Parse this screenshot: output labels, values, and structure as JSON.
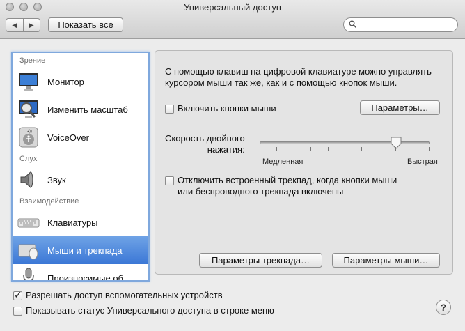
{
  "window": {
    "title": "Универсальный доступ"
  },
  "toolbar": {
    "show_all_label": "Показать все"
  },
  "sidebar": {
    "groups": [
      {
        "label": "Зрение"
      },
      {
        "label": "Слух"
      },
      {
        "label": "Взаимодействие"
      }
    ],
    "items": [
      {
        "label": "Монитор",
        "icon": "monitor-icon"
      },
      {
        "label": "Изменить масштаб",
        "icon": "zoom-icon"
      },
      {
        "label": "VoiceOver",
        "icon": "voiceover-icon"
      },
      {
        "label": "Звук",
        "icon": "speaker-icon"
      },
      {
        "label": "Клавиатуры",
        "icon": "keyboard-icon"
      },
      {
        "label": "Мыши и трекпада",
        "icon": "mouse-icon",
        "selected": true
      },
      {
        "label": "Произносимые об",
        "icon": "microphone-icon"
      }
    ]
  },
  "panel": {
    "description": "С помощью клавиш на цифровой клавиатуре можно управлять курсором мыши так же, как и с помощью кнопок мыши.",
    "enable_mouse_keys_label": "Включить кнопки мыши",
    "enable_mouse_keys_checked": false,
    "options_button_label": "Параметры…",
    "double_click_speed_label_1": "Скорость двойного",
    "double_click_speed_label_2": "нажатия:",
    "slider_slow_label": "Медленная",
    "slider_fast_label": "Быстрая",
    "slider_value_fraction": 0.8,
    "ignore_trackpad_label_1": "Отключить встроенный трекпад, когда кнопки мыши",
    "ignore_trackpad_label_2": "или беспроводного трекпада включены",
    "ignore_trackpad_checked": false,
    "trackpad_options_label": "Параметры трекпада…",
    "mouse_options_label": "Параметры мыши…"
  },
  "footer": {
    "allow_assistive_label": "Разрешать доступ вспомогательных устройств",
    "allow_assistive_checked": true,
    "show_status_label": "Показывать статус Универсального доступа в строке меню",
    "show_status_checked": false,
    "help_label": "?"
  }
}
